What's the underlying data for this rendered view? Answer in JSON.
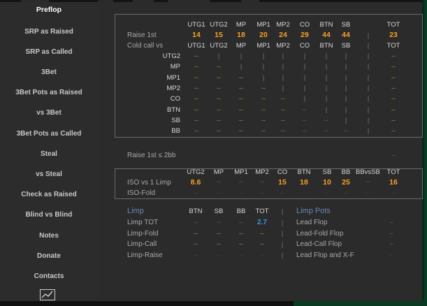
{
  "sidebar": {
    "items": [
      {
        "label": "Preflop",
        "active": true
      },
      {
        "label": "SRP as Raised"
      },
      {
        "label": "SRP as Called"
      },
      {
        "label": "3Bet"
      },
      {
        "label": "3Bet Pots as Raised"
      },
      {
        "label": "vs 3Bet"
      },
      {
        "label": "3Bet Pots as Called"
      },
      {
        "label": "Steal"
      },
      {
        "label": "vs Steal"
      },
      {
        "label": "Check as Raised"
      },
      {
        "label": "Blind vs Blind"
      },
      {
        "label": "Notes"
      },
      {
        "label": "Donate"
      },
      {
        "label": "Contacts"
      }
    ],
    "chart_icon": "line-chart-icon"
  },
  "rfi": {
    "headers": [
      "UTG1",
      "UTG2",
      "MP",
      "MP1",
      "MP2",
      "CO",
      "BTN",
      "SB",
      "",
      "TOT"
    ],
    "raise_label": "Raise 1st",
    "raise_values": [
      "14",
      "15",
      "18",
      "20",
      "24",
      "29",
      "44",
      "44",
      "",
      "23"
    ],
    "cold_label": "Cold call vs",
    "cold_headers": [
      "UTG1",
      "UTG2",
      "MP",
      "MP1",
      "MP2",
      "CO",
      "BTN",
      "SB",
      "",
      "TOT"
    ],
    "rows": [
      {
        "label": "UTG2",
        "cells": [
          "--",
          "|",
          "|",
          "|",
          "|",
          "|",
          "|",
          "|",
          "|",
          "--"
        ]
      },
      {
        "label": "MP",
        "cells": [
          "--",
          "--",
          "|",
          "|",
          "|",
          "|",
          "|",
          "|",
          "|",
          "--"
        ]
      },
      {
        "label": "MP1",
        "cells": [
          "--",
          "--",
          "--",
          "|",
          "|",
          "|",
          "|",
          "|",
          "|",
          "--"
        ]
      },
      {
        "label": "MP2",
        "cells": [
          "--",
          "--",
          "--",
          "--",
          "|",
          "|",
          "|",
          "|",
          "|",
          "--"
        ]
      },
      {
        "label": "CO",
        "cells": [
          "--",
          "--",
          "--",
          "--",
          "--",
          "|",
          "|",
          "|",
          "|",
          "--"
        ]
      },
      {
        "label": "BTN",
        "cells": [
          "--",
          "--",
          "--",
          "--",
          "--",
          "--",
          "|",
          "|",
          "|",
          "--"
        ]
      },
      {
        "label": "SB",
        "cells": [
          "--",
          "--",
          "--",
          "--",
          "--",
          "--",
          "--",
          "|",
          "|",
          "--"
        ]
      },
      {
        "label": "BB",
        "cells": [
          "--",
          "--",
          "--",
          "--",
          "--",
          "--",
          "--",
          "--",
          "|",
          "--"
        ]
      }
    ]
  },
  "raise_small": {
    "label": "Raise 1st ≤ 2bb",
    "value": "--"
  },
  "iso": {
    "headers": [
      "UTG2",
      "MP",
      "MP1",
      "MP2",
      "CO",
      "BTN",
      "SB",
      "BB",
      "BBvsSB",
      "TOT"
    ],
    "row1_label": "ISO vs 1 Limp",
    "row1_values": [
      "8.6",
      "--",
      "--",
      "--",
      "15",
      "18",
      "10",
      "25",
      "--",
      "16"
    ],
    "row2_label": "ISO-Fold",
    "row2_values": [
      "--",
      "--",
      "--",
      "--",
      "--",
      "--",
      "--",
      "--",
      "--",
      "--"
    ]
  },
  "limp": {
    "title": "Limp",
    "headers": [
      "BTN",
      "SB",
      "BB",
      "TOT"
    ],
    "rows": [
      {
        "label": "Limp TOT",
        "values": [
          "--",
          "--",
          "--",
          "2.7"
        ]
      },
      {
        "label": "Limp-Fold",
        "values": [
          "--",
          "--",
          "--",
          "--"
        ]
      },
      {
        "label": "Limp-Call",
        "values": [
          "--",
          "--",
          "--",
          "--"
        ]
      },
      {
        "label": "Limp-Raise",
        "values": [
          "--",
          "--",
          "--",
          "--"
        ]
      }
    ]
  },
  "limp_pots": {
    "title": "Limp Pots",
    "rows": [
      {
        "label": "Lead Flop",
        "value": "--"
      },
      {
        "label": "Lead-Fold Flop",
        "value": "--"
      },
      {
        "label": "Lead-Call Flop",
        "value": "--"
      },
      {
        "label": "Lead Flop and X-F",
        "value": "--"
      }
    ]
  },
  "colors": {
    "accent_orange": "#f7a125",
    "accent_blue": "#3a97e0",
    "dash_yellow": "#9b9a1e",
    "section_blue": "#6a86b8"
  }
}
